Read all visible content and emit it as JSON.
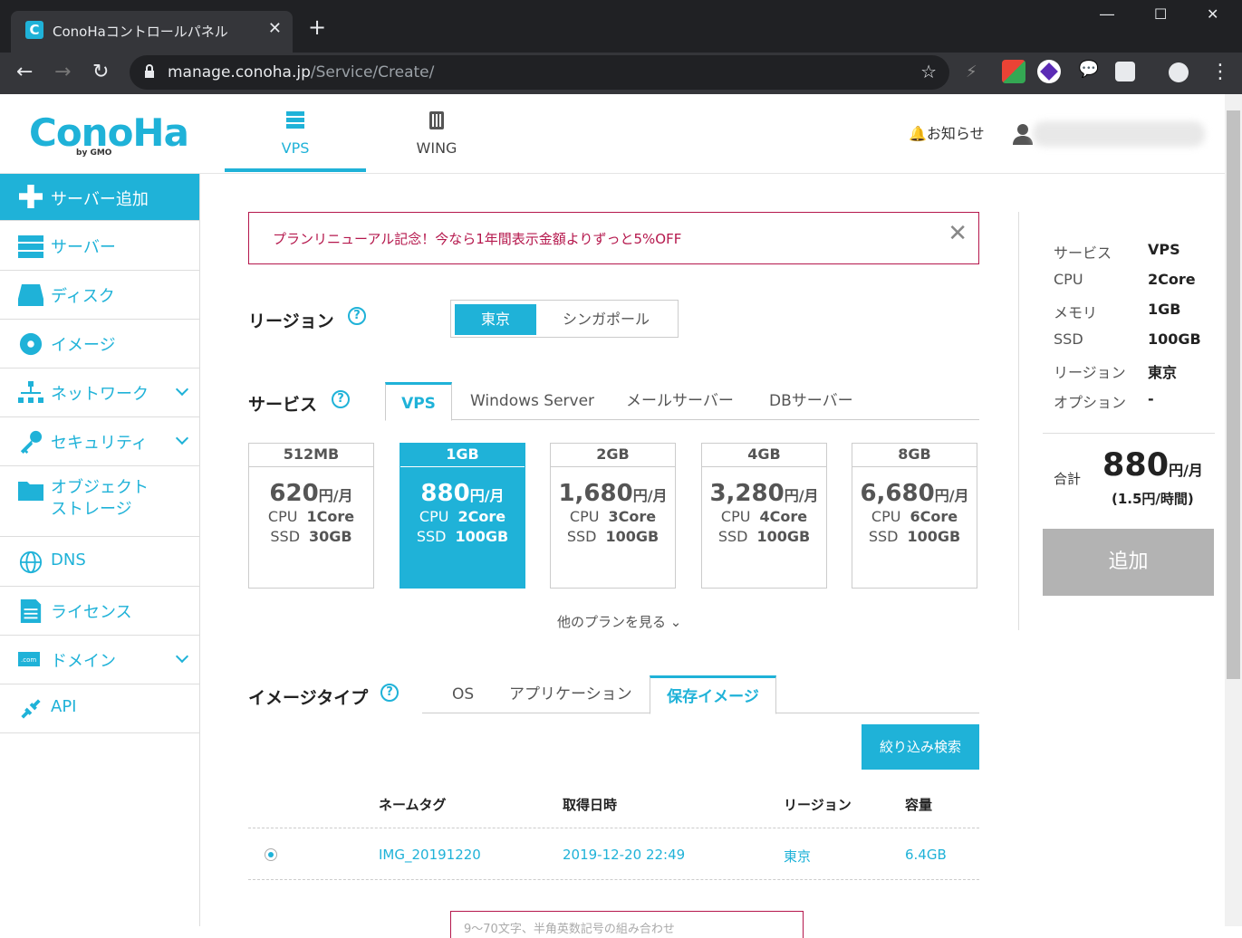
{
  "browser": {
    "tab_title": "ConoHaコントロールパネル",
    "url_host": "manage.conoha.jp",
    "url_path": "/Service/Create/"
  },
  "header": {
    "logo": "ConoHa",
    "logo_sub": "by GMO",
    "tabs": [
      {
        "label": "VPS"
      },
      {
        "label": "WING"
      }
    ],
    "notice": "お知らせ"
  },
  "sidebar": {
    "items": [
      {
        "label": "サーバー追加"
      },
      {
        "label": "サーバー"
      },
      {
        "label": "ディスク"
      },
      {
        "label": "イメージ"
      },
      {
        "label": "ネットワーク"
      },
      {
        "label": "セキュリティ"
      },
      {
        "label": "オブジェクト\nストレージ"
      },
      {
        "label": "DNS"
      },
      {
        "label": "ライセンス"
      },
      {
        "label": "ドメイン"
      },
      {
        "label": "API"
      }
    ]
  },
  "banner": {
    "text": "プランリニューアル記念！今なら1年間表示金額よりずっと5%OFF"
  },
  "region": {
    "label": "リージョン",
    "options": [
      "東京",
      "シンガポール"
    ]
  },
  "service": {
    "label": "サービス",
    "tabs": [
      "VPS",
      "Windows Server",
      "メールサーバー",
      "DBサーバー"
    ]
  },
  "plans": [
    {
      "name": "512MB",
      "price": "620",
      "unit": "円/月",
      "cpu_label": "CPU",
      "cpu": "1Core",
      "ssd_label": "SSD",
      "ssd": "30GB"
    },
    {
      "name": "1GB",
      "price": "880",
      "unit": "円/月",
      "cpu_label": "CPU",
      "cpu": "2Core",
      "ssd_label": "SSD",
      "ssd": "100GB"
    },
    {
      "name": "2GB",
      "price": "1,680",
      "unit": "円/月",
      "cpu_label": "CPU",
      "cpu": "3Core",
      "ssd_label": "SSD",
      "ssd": "100GB"
    },
    {
      "name": "4GB",
      "price": "3,280",
      "unit": "円/月",
      "cpu_label": "CPU",
      "cpu": "4Core",
      "ssd_label": "SSD",
      "ssd": "100GB"
    },
    {
      "name": "8GB",
      "price": "6,680",
      "unit": "円/月",
      "cpu_label": "CPU",
      "cpu": "6Core",
      "ssd_label": "SSD",
      "ssd": "100GB"
    }
  ],
  "more_plans": "他のプランを見る",
  "image_type": {
    "label": "イメージタイプ",
    "tabs": [
      "OS",
      "アプリケーション",
      "保存イメージ"
    ]
  },
  "filter_button": "絞り込み検索",
  "table": {
    "headers": [
      "ネームタグ",
      "取得日時",
      "リージョン",
      "容量"
    ],
    "rows": [
      [
        "IMG_20191220",
        "2019-12-20 22:49",
        "東京",
        "6.4GB"
      ]
    ]
  },
  "bottom_hint": "9～70文字、半角英数記号の組み合わせ",
  "summary": {
    "rows": [
      {
        "k": "サービス",
        "v": "VPS"
      },
      {
        "k": "CPU",
        "v": "2Core"
      },
      {
        "k": "メモリ",
        "v": "1GB"
      },
      {
        "k": "SSD",
        "v": "100GB"
      },
      {
        "k": "リージョン",
        "v": "東京"
      },
      {
        "k": "オプション",
        "v": "-"
      }
    ],
    "total_label": "合計",
    "total_value": "880",
    "total_unit": "円/月",
    "hourly": "(1.5円/時間)",
    "add_button": "追加"
  },
  "colors": {
    "accent": "#1fb2d8",
    "alert": "#b5174c",
    "disabled": "#b3b3b3"
  }
}
